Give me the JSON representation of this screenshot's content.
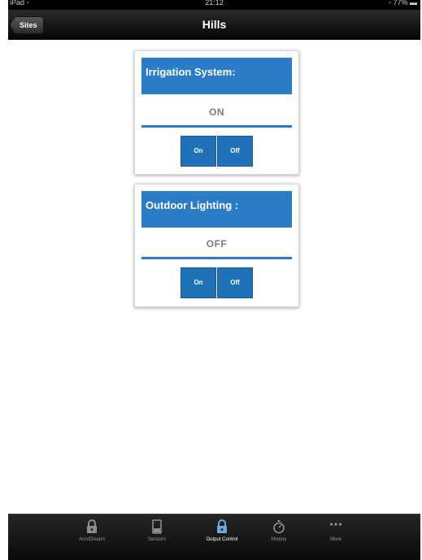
{
  "status_bar": {
    "carrier": "iPad ◦",
    "time": "21:12",
    "battery": "◦ 77% ▬"
  },
  "nav": {
    "back_label": "Sites",
    "title": "Hills"
  },
  "cards": [
    {
      "title": "Irrigation System:",
      "status": "ON",
      "on_label": "On",
      "off_label": "Off"
    },
    {
      "title": "Outdoor Lighting :",
      "status": "OFF",
      "on_label": "On",
      "off_label": "Off"
    }
  ],
  "tabs": [
    {
      "label": "Arm/Disarm",
      "icon": "padlock-icon"
    },
    {
      "label": "Sensors",
      "icon": "door-sensor-icon"
    },
    {
      "label": "Output Control",
      "icon": "padlock-icon",
      "active": true
    },
    {
      "label": "History",
      "icon": "stopwatch-icon"
    },
    {
      "label": "More",
      "icon": "more-dots-icon"
    }
  ],
  "colors": {
    "accent": "#2a7cc7",
    "button": "#1f72b8",
    "status_text": "#7b7b7b"
  }
}
